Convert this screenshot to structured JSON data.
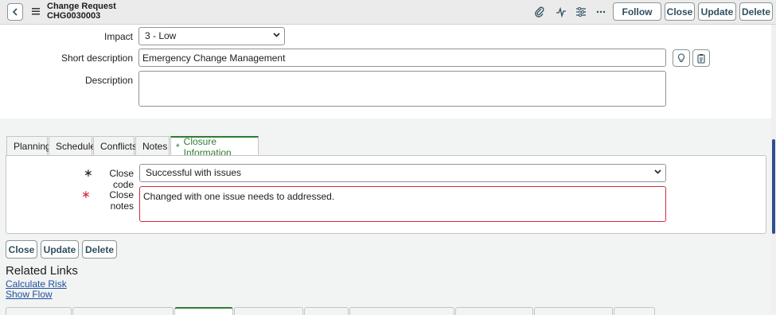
{
  "header": {
    "record_type": "Change Request",
    "record_number": "CHG0030003",
    "buttons": {
      "follow": "Follow",
      "close": "Close",
      "update": "Update",
      "delete": "Delete"
    }
  },
  "form": {
    "impact": {
      "label": "Impact",
      "value": "3 - Low"
    },
    "short_description": {
      "label": "Short description",
      "value": "Emergency Change Management"
    },
    "description": {
      "label": "Description",
      "value": ""
    }
  },
  "tabs": [
    {
      "label": "Planning"
    },
    {
      "label": "Schedule"
    },
    {
      "label": "Conflicts"
    },
    {
      "label": "Notes"
    },
    {
      "label": "Closure Information",
      "modified_marker": "*"
    }
  ],
  "closure": {
    "close_code": {
      "label": "Close code",
      "value": "Successful with issues"
    },
    "close_notes": {
      "label": "Close notes",
      "value": "Changed with one issue needs to addressed."
    },
    "required_marker": "∗"
  },
  "bottom_buttons": {
    "close": "Close",
    "update": "Update",
    "delete": "Delete"
  },
  "related_links": {
    "title": "Related Links",
    "links": [
      "Calculate Risk",
      "Show Flow"
    ]
  },
  "colors": {
    "accent_green": "#2e7d32",
    "required_red": "#d6293a",
    "link_blue": "#1f4e9d",
    "button_text": "#2e4f5f"
  }
}
